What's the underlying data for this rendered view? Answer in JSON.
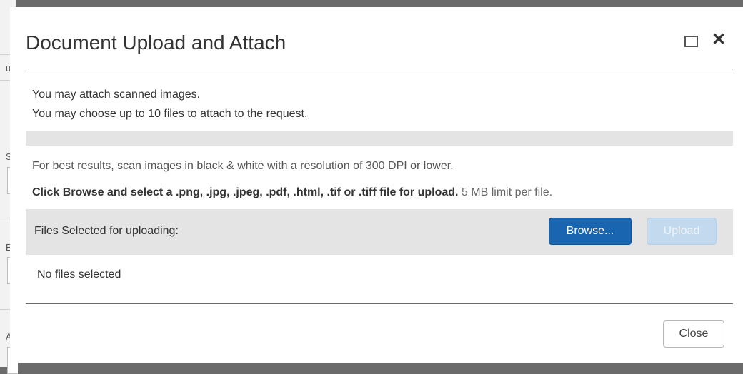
{
  "background": {
    "chars": [
      "u",
      "S",
      "E",
      "A"
    ]
  },
  "dialog": {
    "title": "Document Upload and Attach",
    "intro_line1": "You may attach scanned images.",
    "intro_line2": "You may choose up to 10 files to attach to the request.",
    "best_results": "For best results, scan images in black & white with a resolution of 300 DPI or lower.",
    "instructions_bold": "Click Browse and select a .png, .jpg, .jpeg, .pdf, .html, .tif or .tiff file for upload.",
    "size_limit": "5 MB limit per file.",
    "files_label": "Files Selected for uploading:",
    "browse_label": "Browse...",
    "upload_label": "Upload",
    "upload_enabled": false,
    "no_files": "No files selected",
    "close_label": "Close"
  },
  "colors": {
    "primary_button": "#1a65b0",
    "disabled_button": "#c3d9ee",
    "panel_grey": "#e4e4e4",
    "overlay": "#6b6b6b"
  },
  "icons": [
    "maximize-icon",
    "close-icon"
  ]
}
